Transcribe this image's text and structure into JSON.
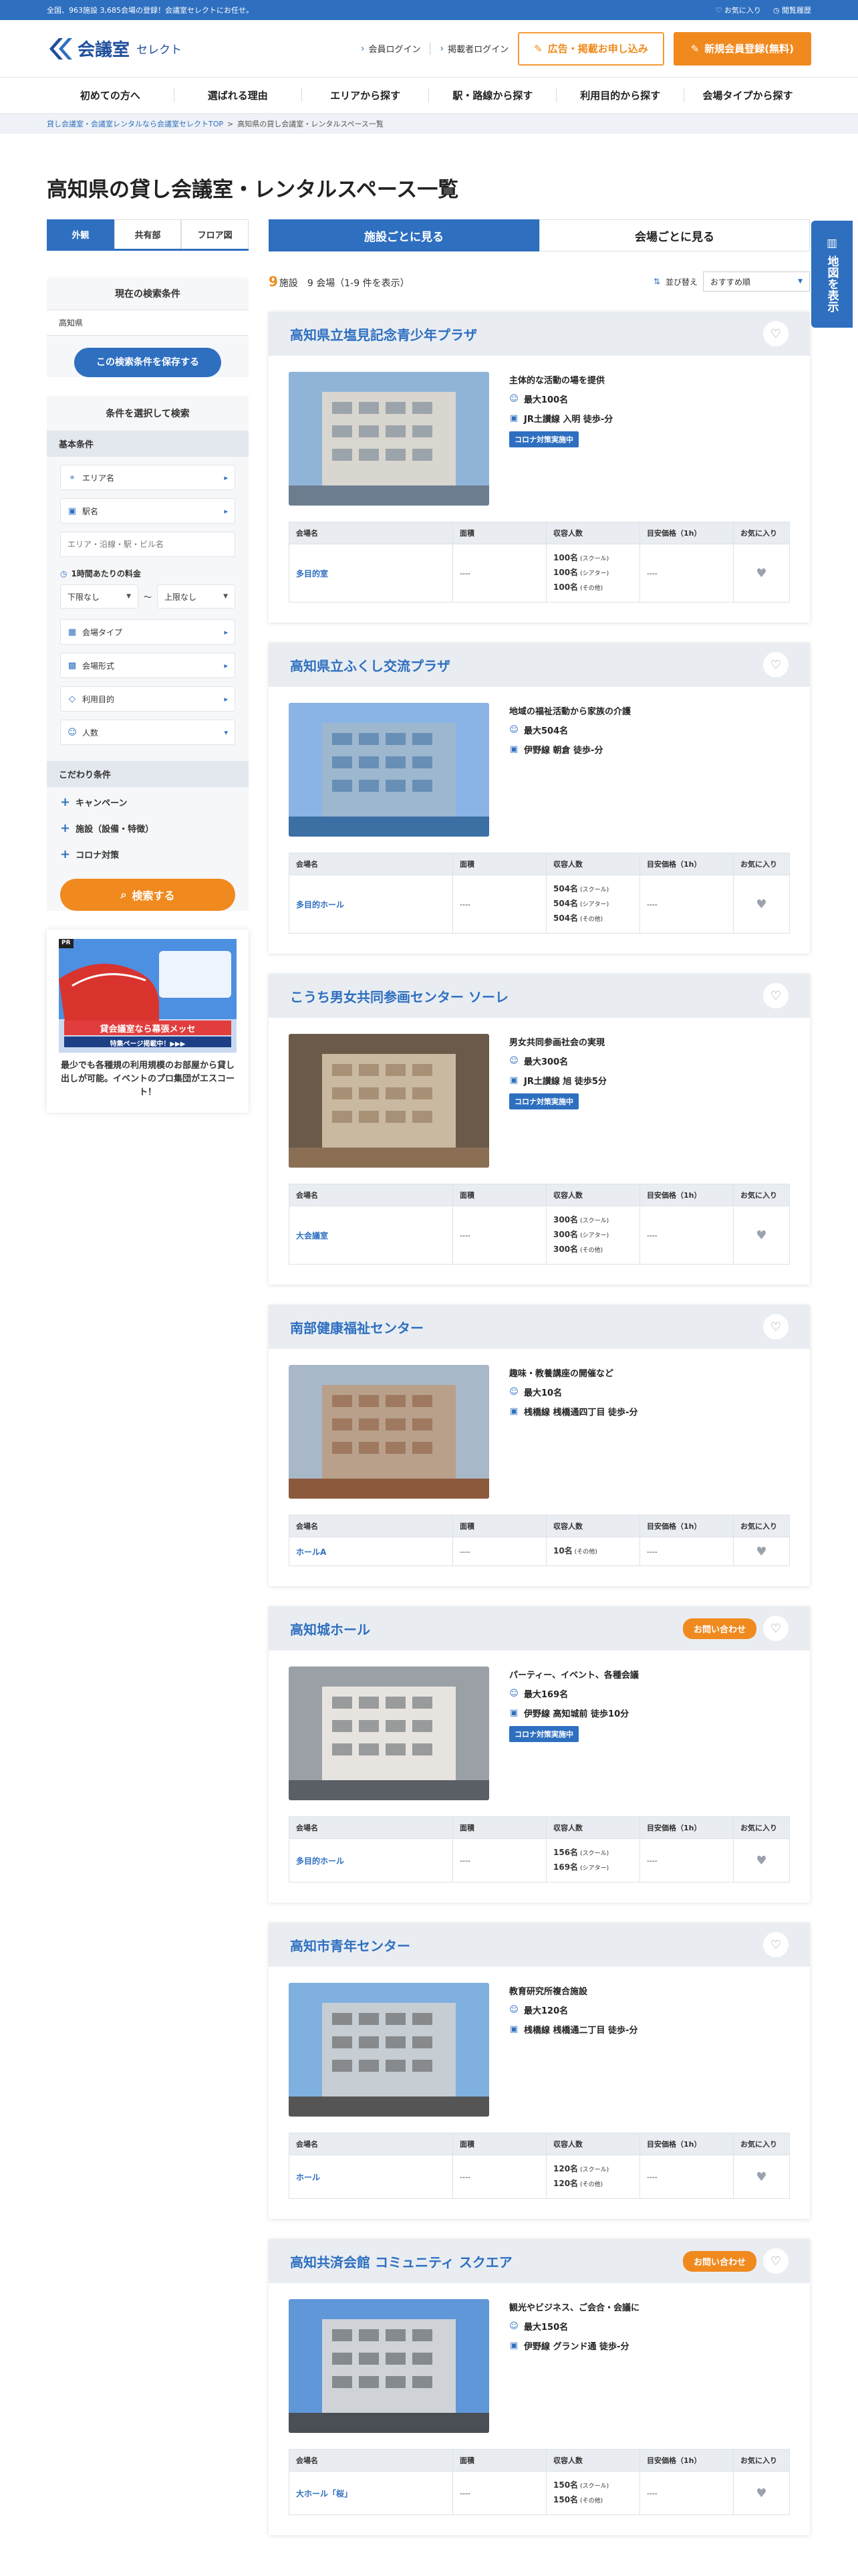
{
  "topbar": {
    "left": "全国、963施設 3,685会場の登録！会議室セレクトにお任せ。",
    "fav": "お気に入り",
    "history": "閲覧履歴"
  },
  "header": {
    "logo_main": "会議室",
    "logo_sub": "セレクト",
    "member_login": "会員ログイン",
    "owner_login": "掲載者ログイン",
    "ad_btn": "広告・掲載お申し込み",
    "reg_btn": "新規会員登録(無料)"
  },
  "gnav": [
    "初めての方へ",
    "選ばれる理由",
    "エリアから探す",
    "駅・路線から探す",
    "利用目的から探す",
    "会場タイプから探す"
  ],
  "crumb": {
    "c1": "貸し会議室・会議室レンタルなら会議室セレクトTOP",
    "c2": "高知県の貸し会議室・レンタルスペース一覧"
  },
  "title": "高知県の貸し会議室・レンタルスペース一覧",
  "side": {
    "tabs": [
      "外観",
      "共有部",
      "フロア図"
    ],
    "cond_title": "現在の検索条件",
    "cond_value": "高知県",
    "save": "この検索条件を保存する",
    "search_title": "条件を選択して検索",
    "basic": "基本条件",
    "area": "エリア名",
    "station": "駅名",
    "placeholder": "エリア・沿線・駅・ビル名",
    "price": "1時間あたりの料金",
    "min": "下限なし",
    "tilde": "〜",
    "max": "上限なし",
    "type": "会場タイプ",
    "format": "会場形式",
    "purpose": "利用目的",
    "people": "人数",
    "kodawari": "こだわり条件",
    "campaign": "キャンペーン",
    "facility": "施設（設備・特徴）",
    "corona": "コロナ対策",
    "search_btn": "検索する",
    "banner_pr": "PR",
    "banner_line1": "貸会議室なら幕張メッセ",
    "banner_line2": "特集ページ掲載中！▶▶▶",
    "banner_text": "最少でも各種規の利用規模のお部屋から貸し出しが可能。イベントのプロ集団がエスコート！"
  },
  "main": {
    "tab1": "施設ごとに見る",
    "tab2": "会場ごとに見る",
    "count_num": "9",
    "count_text": "施設　9 会場（1-9 件を表示）",
    "sort_label": "並び替え",
    "sort_value": "おすすめ順",
    "map_btn": "地図を表示",
    "th": [
      "会場名",
      "面積",
      "収容人数",
      "目安価格（1h）",
      "お気に入り"
    ]
  },
  "venues": [
    {
      "name": "高知県立塩見記念青少年プラザ",
      "desc": "主体的な活動の場を提供",
      "max": "最大100名",
      "access": "JR土讃線 入明 徒歩-分",
      "corona": "コロナ対策実施中",
      "contact": "",
      "room": "多目的室",
      "area": "----",
      "caps": [
        [
          "100名",
          "(スクール)"
        ],
        [
          "100名",
          "(シアター)"
        ],
        [
          "100名",
          "(その他)"
        ]
      ],
      "price": "----"
    },
    {
      "name": "高知県立ふくし交流プラザ",
      "desc": "地域の福祉活動から家族の介護",
      "max": "最大504名",
      "access": "伊野線 朝倉 徒歩-分",
      "corona": "",
      "contact": "",
      "room": "多目的ホール",
      "area": "----",
      "caps": [
        [
          "504名",
          "(スクール)"
        ],
        [
          "504名",
          "(シアター)"
        ],
        [
          "504名",
          "(その他)"
        ]
      ],
      "price": "----"
    },
    {
      "name": "こうち男女共同参画センター ソーレ",
      "desc": "男女共同参画社会の実現",
      "max": "最大300名",
      "access": "JR土讃線 旭 徒歩5分",
      "corona": "コロナ対策実施中",
      "contact": "",
      "room": "大会議室",
      "area": "----",
      "caps": [
        [
          "300名",
          "(スクール)"
        ],
        [
          "300名",
          "(シアター)"
        ],
        [
          "300名",
          "(その他)"
        ]
      ],
      "price": "----"
    },
    {
      "name": "南部健康福祉センター",
      "desc": "趣味・教養講座の開催など",
      "max": "最大10名",
      "access": "桟橋線 桟橋通四丁目 徒歩-分",
      "corona": "",
      "contact": "",
      "room": "ホールA",
      "area": "----",
      "caps": [
        [
          "10名",
          "(その他)"
        ]
      ],
      "price": "----"
    },
    {
      "name": "高知城ホール",
      "desc": "パーティー、イベント、各種会議",
      "max": "最大169名",
      "access": "伊野線 高知城前 徒歩10分",
      "corona": "コロナ対策実施中",
      "contact": "お問い合わせ",
      "room": "多目的ホール",
      "area": "----",
      "caps": [
        [
          "156名",
          "(スクール)"
        ],
        [
          "169名",
          "(シアター)"
        ]
      ],
      "price": "----"
    },
    {
      "name": "高知市青年センター",
      "desc": "教育研究所複合施設",
      "max": "最大120名",
      "access": "桟橋線 桟橋通二丁目 徒歩-分",
      "corona": "",
      "contact": "",
      "room": "ホール",
      "area": "----",
      "caps": [
        [
          "120名",
          "(スクール)"
        ],
        [
          "120名",
          "(その他)"
        ]
      ],
      "price": "----"
    },
    {
      "name": "高知共済会館 コミュニティ スクエア",
      "desc": "観光やビジネス、ご会合・会議に",
      "max": "最大150名",
      "access": "伊野線 グランド通 徒歩-分",
      "corona": "",
      "contact": "お問い合わせ",
      "room": "大ホール「桜」",
      "area": "----",
      "caps": [
        [
          "150名",
          "(スクール)"
        ],
        [
          "150名",
          "(その他)"
        ]
      ],
      "price": "----"
    }
  ],
  "icons": {
    "person": "person-icon",
    "train": "train-icon",
    "heart": "heart-icon",
    "search": "search-icon",
    "map": "map-icon"
  }
}
